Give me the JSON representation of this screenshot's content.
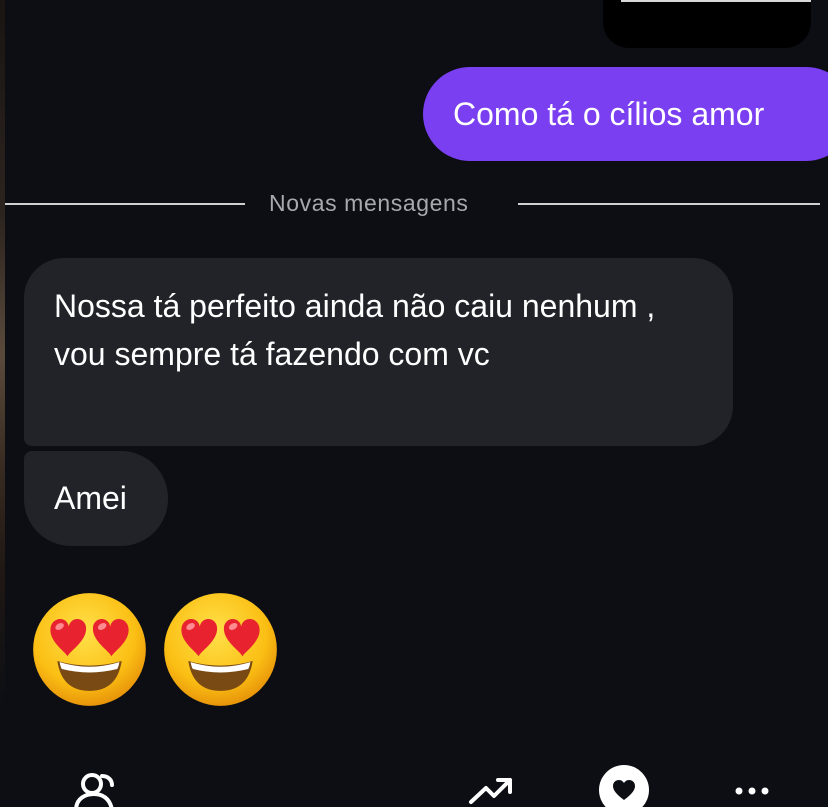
{
  "conversation": {
    "sent_messages": [
      {
        "text": "Como tá o cílios amor"
      }
    ],
    "divider_label": "Novas mensagens",
    "received_messages": [
      {
        "text": "Nossa tá perfeito ainda não caiu nenhum , vou sempre tá fazendo com vc"
      },
      {
        "text": "Amei"
      }
    ],
    "emoji_message": {
      "emojis": [
        "smiling-face-with-heart-eyes",
        "smiling-face-with-heart-eyes"
      ]
    }
  },
  "toolbar": {
    "icons": [
      "people-icon",
      "trending-icon",
      "heart-icon",
      "more-icon"
    ]
  },
  "colors": {
    "background": "#0c0e14",
    "sent_bubble": "#7b3ff2",
    "received_bubble": "#212329",
    "divider_text": "#a8a8ad"
  }
}
